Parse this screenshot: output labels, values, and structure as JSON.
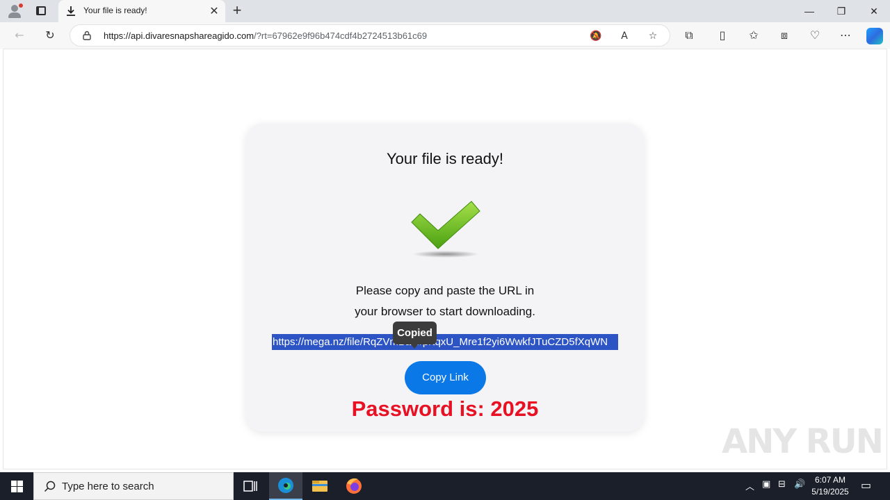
{
  "browser": {
    "tab_title": "Your file is ready!",
    "new_tab": "+",
    "url_host": "https://api.divaresnapshareagido.com",
    "url_rest": "/?rt=67962e9f96b474cdf4b2724513b61c69",
    "window_controls": {
      "minimize": "—",
      "restore": "❐",
      "close": "✕"
    }
  },
  "page": {
    "title": "Your file is ready!",
    "instruction_line1": "Please copy and paste the URL in",
    "instruction_line2": "your browser to start downloading.",
    "link": "https://mega.nz/file/RqZVmBad#prtqxU_Mre1f2yi6WwkfJTuCZD5fXqWN",
    "tooltip": "Copied",
    "copy_button": "Copy Link",
    "password": "Password is: 2025",
    "accent_color": "#0a78e6",
    "password_color": "#e81123"
  },
  "watermark": "ANY RUN",
  "taskbar": {
    "search_placeholder": "Type here to search",
    "time": "6:07 AM",
    "date": "5/19/2025"
  }
}
